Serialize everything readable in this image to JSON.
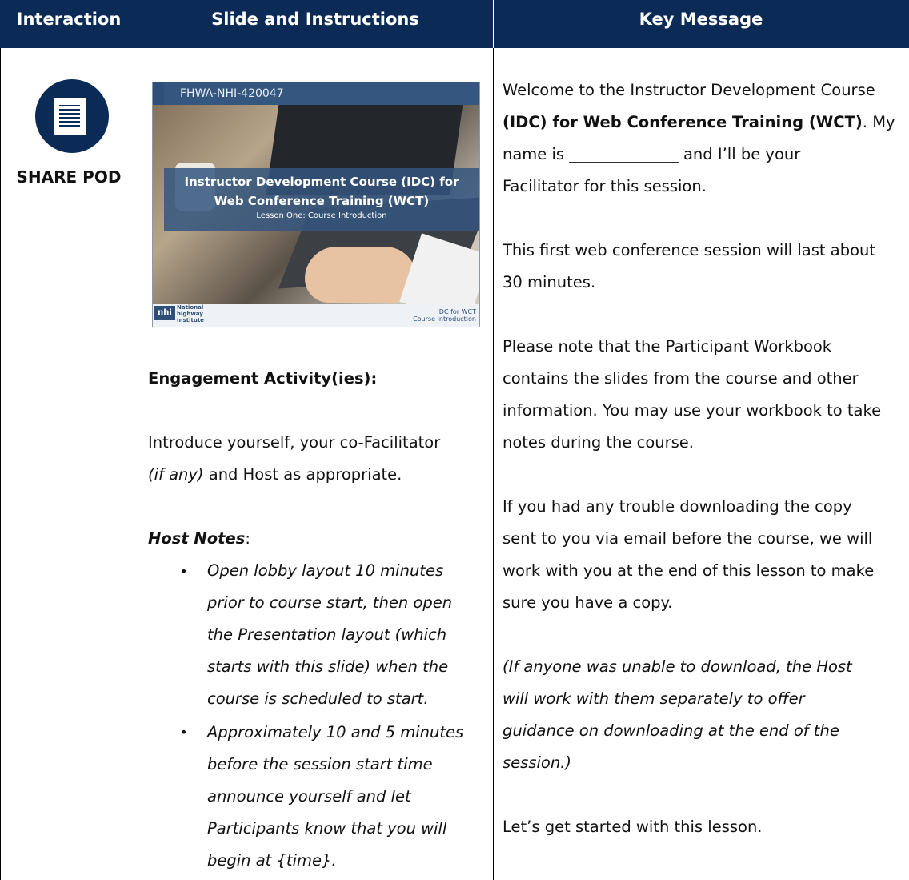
{
  "header": {
    "col1": "Interaction",
    "col2": "Slide and Instructions",
    "col3": "Key Message"
  },
  "interaction": {
    "label": "SHARE POD",
    "icon": "document-icon"
  },
  "slide": {
    "course_code": "FHWA-NHI-420047",
    "title_line1": "Instructor Development Course (IDC) for",
    "title_line2": "Web Conference Training (WCT)",
    "subtitle": "Lesson One: Course Introduction",
    "logo_text": "nhi",
    "logo_sub1": "National",
    "logo_sub2": "highway",
    "logo_sub3": "Institute",
    "footer_right_1": "IDC for WCT",
    "footer_right_2": "Course Introduction"
  },
  "instructions": {
    "engagement_heading": "Engagement Activity(ies):",
    "intro_line1": "Introduce yourself, your co-Facilitator",
    "intro_line2_a": "(if any)",
    "intro_line2_b": " and Host as appropriate.",
    "host_notes_label": "Host Notes",
    "host_notes_colon": ":",
    "bullets": [
      [
        "Open lobby layout 10 minutes",
        "prior to course start, then open",
        "the Presentation layout (which",
        "starts with this slide) when the",
        "course is scheduled to start."
      ],
      [
        "Approximately 10 and 5 minutes",
        "before the session start time",
        "announce yourself and let",
        "Participants know that you will",
        "begin at {time}."
      ]
    ]
  },
  "key_message": {
    "l1": "Welcome to the Instructor Development Course",
    "l2a": "(IDC) for Web Conference Training (WCT)",
    "l2b": ".  My",
    "l3": "name is ______________ and I’ll be your",
    "l4": "Facilitator for this session.",
    "l5": "This first web conference session will last about",
    "l6": "30 minutes.",
    "l7": "Please note that the Participant Workbook",
    "l8": "contains the slides from the course and other",
    "l9": "information. You may use your workbook to take",
    "l10": "notes during the course.",
    "l11": "If you had any trouble downloading the copy",
    "l12": "sent to you via email before the course, we will",
    "l13": "work with you at the end of this lesson to make",
    "l14": "sure you have a copy.",
    "l15": "(If anyone was unable to download, the Host",
    "l16": "will work with them separately to offer",
    "l17": "guidance on downloading at the end of the",
    "l18": "session.)",
    "l19": "Let’s get started with this lesson."
  }
}
